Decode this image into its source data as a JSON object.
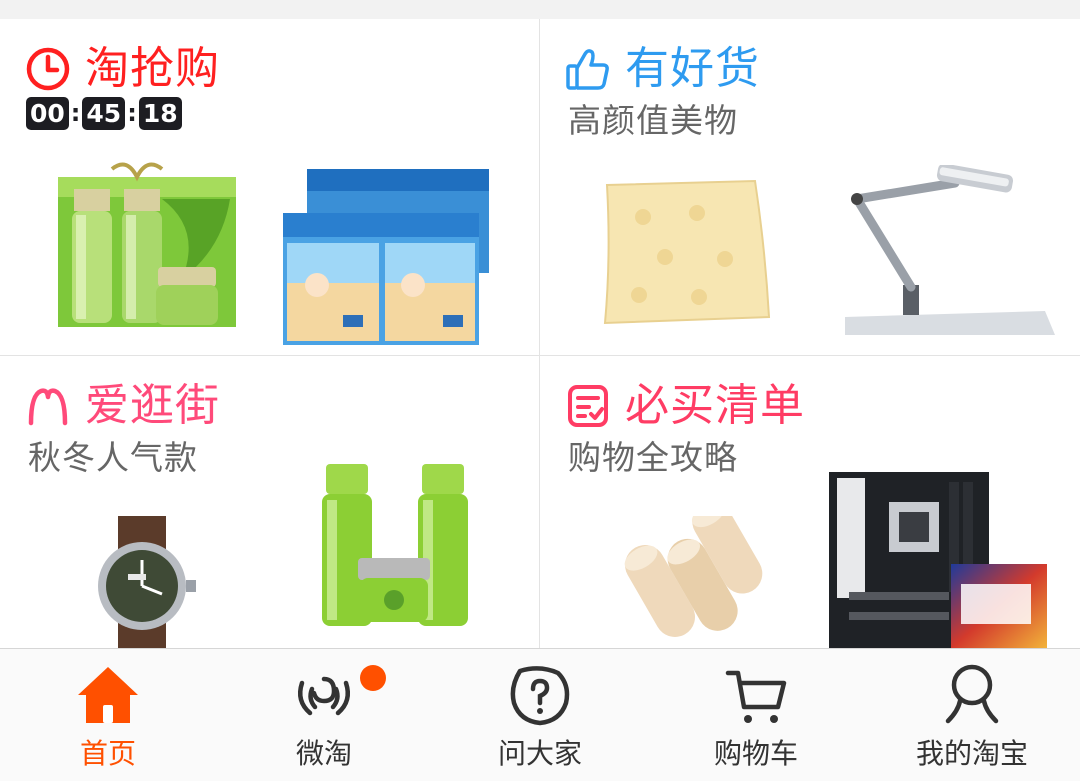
{
  "colors": {
    "qiang_red": "#ff2020",
    "haohuo_blue": "#2e9bf0",
    "guangjie_pink": "#ff4a7a",
    "qingdan_pink": "#ff3c64",
    "tab_active": "#ff5000",
    "tab_inactive": "#333333"
  },
  "cards": {
    "qiang": {
      "title": "淘抢购",
      "icon": "clock-icon",
      "countdown": {
        "hours": "00",
        "minutes": "45",
        "seconds": "18"
      },
      "products": [
        "green-skincare-gift-set",
        "baby-diapers-packs"
      ]
    },
    "haohuo": {
      "title": "有好货",
      "subtitle": "高颜值美物",
      "icon": "thumbs-up-icon",
      "products": [
        "cream-baby-mat",
        "desk-lamp-arm"
      ]
    },
    "guangjie": {
      "title": "爱逛街",
      "subtitle": "秋冬人气款",
      "icon": "smile-arc-icon",
      "products": [
        "leather-watch",
        "green-skincare-bottles"
      ]
    },
    "qingdan": {
      "title": "必买清单",
      "subtitle": "购物全攻略",
      "icon": "checklist-icon",
      "products": [
        "rolled-baby-mats",
        "motherboard-and-cpu-box"
      ]
    }
  },
  "tabbar": {
    "items": [
      {
        "label": "首页",
        "icon": "home-icon",
        "active": true
      },
      {
        "label": "微淘",
        "icon": "broadcast-icon",
        "active": false,
        "badge": true
      },
      {
        "label": "问大家",
        "icon": "question-bubble-icon",
        "active": false
      },
      {
        "label": "购物车",
        "icon": "cart-icon",
        "active": false
      },
      {
        "label": "我的淘宝",
        "icon": "person-icon",
        "active": false
      }
    ]
  }
}
